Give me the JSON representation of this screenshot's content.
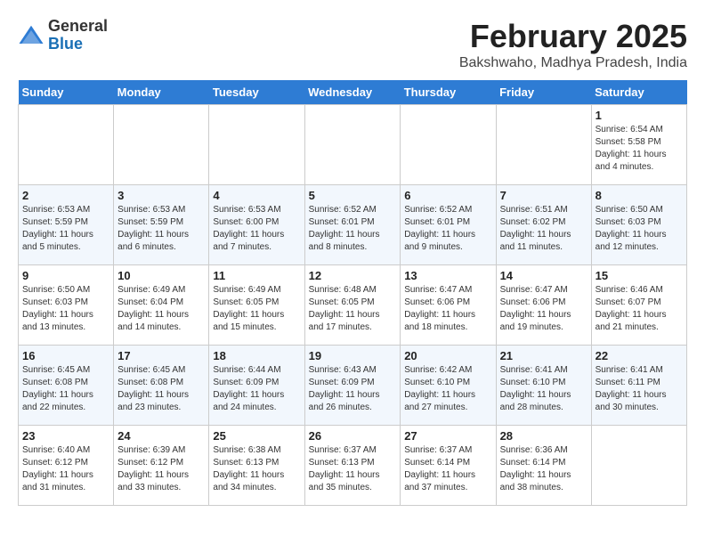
{
  "header": {
    "logo_general": "General",
    "logo_blue": "Blue",
    "title": "February 2025",
    "subtitle": "Bakshwaho, Madhya Pradesh, India"
  },
  "weekdays": [
    "Sunday",
    "Monday",
    "Tuesday",
    "Wednesday",
    "Thursday",
    "Friday",
    "Saturday"
  ],
  "weeks": [
    [
      {
        "day": "",
        "info": ""
      },
      {
        "day": "",
        "info": ""
      },
      {
        "day": "",
        "info": ""
      },
      {
        "day": "",
        "info": ""
      },
      {
        "day": "",
        "info": ""
      },
      {
        "day": "",
        "info": ""
      },
      {
        "day": "1",
        "info": "Sunrise: 6:54 AM\nSunset: 5:58 PM\nDaylight: 11 hours\nand 4 minutes."
      }
    ],
    [
      {
        "day": "2",
        "info": "Sunrise: 6:53 AM\nSunset: 5:59 PM\nDaylight: 11 hours\nand 5 minutes."
      },
      {
        "day": "3",
        "info": "Sunrise: 6:53 AM\nSunset: 5:59 PM\nDaylight: 11 hours\nand 6 minutes."
      },
      {
        "day": "4",
        "info": "Sunrise: 6:53 AM\nSunset: 6:00 PM\nDaylight: 11 hours\nand 7 minutes."
      },
      {
        "day": "5",
        "info": "Sunrise: 6:52 AM\nSunset: 6:01 PM\nDaylight: 11 hours\nand 8 minutes."
      },
      {
        "day": "6",
        "info": "Sunrise: 6:52 AM\nSunset: 6:01 PM\nDaylight: 11 hours\nand 9 minutes."
      },
      {
        "day": "7",
        "info": "Sunrise: 6:51 AM\nSunset: 6:02 PM\nDaylight: 11 hours\nand 11 minutes."
      },
      {
        "day": "8",
        "info": "Sunrise: 6:50 AM\nSunset: 6:03 PM\nDaylight: 11 hours\nand 12 minutes."
      }
    ],
    [
      {
        "day": "9",
        "info": "Sunrise: 6:50 AM\nSunset: 6:03 PM\nDaylight: 11 hours\nand 13 minutes."
      },
      {
        "day": "10",
        "info": "Sunrise: 6:49 AM\nSunset: 6:04 PM\nDaylight: 11 hours\nand 14 minutes."
      },
      {
        "day": "11",
        "info": "Sunrise: 6:49 AM\nSunset: 6:05 PM\nDaylight: 11 hours\nand 15 minutes."
      },
      {
        "day": "12",
        "info": "Sunrise: 6:48 AM\nSunset: 6:05 PM\nDaylight: 11 hours\nand 17 minutes."
      },
      {
        "day": "13",
        "info": "Sunrise: 6:47 AM\nSunset: 6:06 PM\nDaylight: 11 hours\nand 18 minutes."
      },
      {
        "day": "14",
        "info": "Sunrise: 6:47 AM\nSunset: 6:06 PM\nDaylight: 11 hours\nand 19 minutes."
      },
      {
        "day": "15",
        "info": "Sunrise: 6:46 AM\nSunset: 6:07 PM\nDaylight: 11 hours\nand 21 minutes."
      }
    ],
    [
      {
        "day": "16",
        "info": "Sunrise: 6:45 AM\nSunset: 6:08 PM\nDaylight: 11 hours\nand 22 minutes."
      },
      {
        "day": "17",
        "info": "Sunrise: 6:45 AM\nSunset: 6:08 PM\nDaylight: 11 hours\nand 23 minutes."
      },
      {
        "day": "18",
        "info": "Sunrise: 6:44 AM\nSunset: 6:09 PM\nDaylight: 11 hours\nand 24 minutes."
      },
      {
        "day": "19",
        "info": "Sunrise: 6:43 AM\nSunset: 6:09 PM\nDaylight: 11 hours\nand 26 minutes."
      },
      {
        "day": "20",
        "info": "Sunrise: 6:42 AM\nSunset: 6:10 PM\nDaylight: 11 hours\nand 27 minutes."
      },
      {
        "day": "21",
        "info": "Sunrise: 6:41 AM\nSunset: 6:10 PM\nDaylight: 11 hours\nand 28 minutes."
      },
      {
        "day": "22",
        "info": "Sunrise: 6:41 AM\nSunset: 6:11 PM\nDaylight: 11 hours\nand 30 minutes."
      }
    ],
    [
      {
        "day": "23",
        "info": "Sunrise: 6:40 AM\nSunset: 6:12 PM\nDaylight: 11 hours\nand 31 minutes."
      },
      {
        "day": "24",
        "info": "Sunrise: 6:39 AM\nSunset: 6:12 PM\nDaylight: 11 hours\nand 33 minutes."
      },
      {
        "day": "25",
        "info": "Sunrise: 6:38 AM\nSunset: 6:13 PM\nDaylight: 11 hours\nand 34 minutes."
      },
      {
        "day": "26",
        "info": "Sunrise: 6:37 AM\nSunset: 6:13 PM\nDaylight: 11 hours\nand 35 minutes."
      },
      {
        "day": "27",
        "info": "Sunrise: 6:37 AM\nSunset: 6:14 PM\nDaylight: 11 hours\nand 37 minutes."
      },
      {
        "day": "28",
        "info": "Sunrise: 6:36 AM\nSunset: 6:14 PM\nDaylight: 11 hours\nand 38 minutes."
      },
      {
        "day": "",
        "info": ""
      }
    ]
  ]
}
